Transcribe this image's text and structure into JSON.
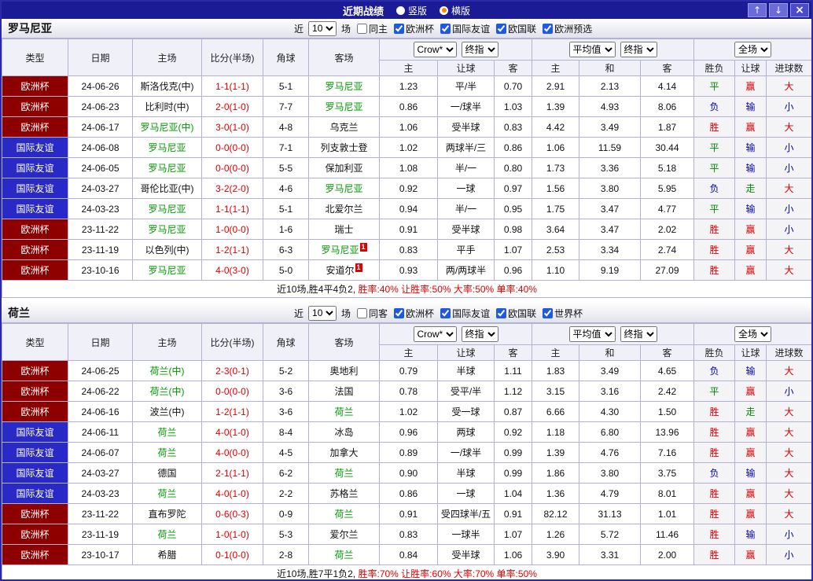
{
  "titlebar": {
    "title": "近期战绩",
    "layout_options": [
      {
        "label": "竖版",
        "selected": false
      },
      {
        "label": "横版",
        "selected": true
      }
    ],
    "selected_index": 1,
    "buttons": {
      "up": "↑",
      "down": "↓",
      "close": "×"
    }
  },
  "labels": {
    "near": "近",
    "games": "场"
  },
  "selectors": {
    "book": "Crow*",
    "book_stage": "终指",
    "avg": "平均值",
    "avg_stage": "终指",
    "scope": "全场"
  },
  "columns": {
    "main": [
      "类型",
      "日期",
      "主场",
      "比分(半场)",
      "角球",
      "客场"
    ],
    "sub": [
      "主",
      "让球",
      "客",
      "主",
      "和",
      "客",
      "胜负",
      "让球",
      "进球数"
    ]
  },
  "colors": {
    "comp": {
      "欧洲杯": "#8e0000",
      "国际友谊": "#2929c8"
    },
    "result": {
      "胜": "#d40000",
      "平": "#008a00",
      "负": "#0000cc",
      "赢": "#d40000",
      "输": "#0000cc",
      "走": "#008a00",
      "大": "#d40000",
      "小": "#0000cc"
    },
    "focal_team": "#009900",
    "score": "#e00000"
  },
  "sections": [
    {
      "team": "罗马尼亚",
      "filter": {
        "count": "10",
        "same_label": "同主",
        "same_checked": false,
        "competitions": [
          {
            "label": "欧洲杯",
            "checked": true
          },
          {
            "label": "国际友谊",
            "checked": true
          },
          {
            "label": "欧国联",
            "checked": true
          },
          {
            "label": "欧洲预选",
            "checked": true
          }
        ]
      },
      "rows": [
        {
          "comp": "欧洲杯",
          "date": "24-06-26",
          "home": "斯洛伐克(中)",
          "score": "1-1(1-1)",
          "corners": "5-1",
          "away": "罗马尼亚",
          "book": [
            "1.23",
            "平/半",
            "0.70"
          ],
          "avg": [
            "2.91",
            "2.13",
            "4.14"
          ],
          "results": [
            "平",
            "赢",
            "大"
          ],
          "home_rc": 0,
          "away_rc": 0
        },
        {
          "comp": "欧洲杯",
          "date": "24-06-23",
          "home": "比利时(中)",
          "score": "2-0(1-0)",
          "corners": "7-7",
          "away": "罗马尼亚",
          "book": [
            "0.86",
            "一/球半",
            "1.03"
          ],
          "avg": [
            "1.39",
            "4.93",
            "8.06"
          ],
          "results": [
            "负",
            "输",
            "小"
          ],
          "home_rc": 0,
          "away_rc": 0
        },
        {
          "comp": "欧洲杯",
          "date": "24-06-17",
          "home": "罗马尼亚(中)",
          "score": "3-0(1-0)",
          "corners": "4-8",
          "away": "乌克兰",
          "book": [
            "1.06",
            "受半球",
            "0.83"
          ],
          "avg": [
            "4.42",
            "3.49",
            "1.87"
          ],
          "results": [
            "胜",
            "赢",
            "大"
          ],
          "home_rc": 0,
          "away_rc": 0
        },
        {
          "comp": "国际友谊",
          "date": "24-06-08",
          "home": "罗马尼亚",
          "score": "0-0(0-0)",
          "corners": "7-1",
          "away": "列支敦士登",
          "book": [
            "1.02",
            "两球半/三",
            "0.86"
          ],
          "avg": [
            "1.06",
            "11.59",
            "30.44"
          ],
          "results": [
            "平",
            "输",
            "小"
          ],
          "home_rc": 0,
          "away_rc": 0
        },
        {
          "comp": "国际友谊",
          "date": "24-06-05",
          "home": "罗马尼亚",
          "score": "0-0(0-0)",
          "corners": "5-5",
          "away": "保加利亚",
          "book": [
            "1.08",
            "半/一",
            "0.80"
          ],
          "avg": [
            "1.73",
            "3.36",
            "5.18"
          ],
          "results": [
            "平",
            "输",
            "小"
          ],
          "home_rc": 0,
          "away_rc": 0
        },
        {
          "comp": "国际友谊",
          "date": "24-03-27",
          "home": "哥伦比亚(中)",
          "score": "3-2(2-0)",
          "corners": "4-6",
          "away": "罗马尼亚",
          "book": [
            "0.92",
            "一球",
            "0.97"
          ],
          "avg": [
            "1.56",
            "3.80",
            "5.95"
          ],
          "results": [
            "负",
            "走",
            "大"
          ],
          "home_rc": 0,
          "away_rc": 0
        },
        {
          "comp": "国际友谊",
          "date": "24-03-23",
          "home": "罗马尼亚",
          "score": "1-1(1-1)",
          "corners": "5-1",
          "away": "北爱尔兰",
          "book": [
            "0.94",
            "半/一",
            "0.95"
          ],
          "avg": [
            "1.75",
            "3.47",
            "4.77"
          ],
          "results": [
            "平",
            "输",
            "小"
          ],
          "home_rc": 0,
          "away_rc": 0
        },
        {
          "comp": "欧洲杯",
          "date": "23-11-22",
          "home": "罗马尼亚",
          "score": "1-0(0-0)",
          "corners": "1-6",
          "away": "瑞士",
          "book": [
            "0.91",
            "受半球",
            "0.98"
          ],
          "avg": [
            "3.64",
            "3.47",
            "2.02"
          ],
          "results": [
            "胜",
            "赢",
            "小"
          ],
          "home_rc": 0,
          "away_rc": 0
        },
        {
          "comp": "欧洲杯",
          "date": "23-11-19",
          "home": "以色列(中)",
          "score": "1-2(1-1)",
          "corners": "6-3",
          "away": "罗马尼亚",
          "book": [
            "0.83",
            "平手",
            "1.07"
          ],
          "avg": [
            "2.53",
            "3.34",
            "2.74"
          ],
          "results": [
            "胜",
            "赢",
            "大"
          ],
          "home_rc": 0,
          "away_rc": 1
        },
        {
          "comp": "欧洲杯",
          "date": "23-10-16",
          "home": "罗马尼亚",
          "score": "4-0(3-0)",
          "corners": "5-0",
          "away": "安道尔",
          "book": [
            "0.93",
            "两/两球半",
            "0.96"
          ],
          "avg": [
            "1.10",
            "9.19",
            "27.09"
          ],
          "results": [
            "胜",
            "赢",
            "大"
          ],
          "home_rc": 0,
          "away_rc": 1
        }
      ],
      "summary": {
        "prefix": "近10场,胜4平4负2,",
        "stats": "胜率:40% 让胜率:50% 大率:50% 单率:40%"
      }
    },
    {
      "team": "荷兰",
      "filter": {
        "count": "10",
        "same_label": "同客",
        "same_checked": false,
        "competitions": [
          {
            "label": "欧洲杯",
            "checked": true
          },
          {
            "label": "国际友谊",
            "checked": true
          },
          {
            "label": "欧国联",
            "checked": true
          },
          {
            "label": "世界杯",
            "checked": true
          }
        ]
      },
      "rows": [
        {
          "comp": "欧洲杯",
          "date": "24-06-25",
          "home": "荷兰(中)",
          "score": "2-3(0-1)",
          "corners": "5-2",
          "away": "奥地利",
          "book": [
            "0.79",
            "半球",
            "1.11"
          ],
          "avg": [
            "1.83",
            "3.49",
            "4.65"
          ],
          "results": [
            "负",
            "输",
            "大"
          ],
          "home_rc": 0,
          "away_rc": 0
        },
        {
          "comp": "欧洲杯",
          "date": "24-06-22",
          "home": "荷兰(中)",
          "score": "0-0(0-0)",
          "corners": "3-6",
          "away": "法国",
          "book": [
            "0.78",
            "受平/半",
            "1.12"
          ],
          "avg": [
            "3.15",
            "3.16",
            "2.42"
          ],
          "results": [
            "平",
            "赢",
            "小"
          ],
          "home_rc": 0,
          "away_rc": 0
        },
        {
          "comp": "欧洲杯",
          "date": "24-06-16",
          "home": "波兰(中)",
          "score": "1-2(1-1)",
          "corners": "3-6",
          "away": "荷兰",
          "book": [
            "1.02",
            "受一球",
            "0.87"
          ],
          "avg": [
            "6.66",
            "4.30",
            "1.50"
          ],
          "results": [
            "胜",
            "走",
            "大"
          ],
          "home_rc": 0,
          "away_rc": 0
        },
        {
          "comp": "国际友谊",
          "date": "24-06-11",
          "home": "荷兰",
          "score": "4-0(1-0)",
          "corners": "8-4",
          "away": "冰岛",
          "book": [
            "0.96",
            "两球",
            "0.92"
          ],
          "avg": [
            "1.18",
            "6.80",
            "13.96"
          ],
          "results": [
            "胜",
            "赢",
            "大"
          ],
          "home_rc": 0,
          "away_rc": 0
        },
        {
          "comp": "国际友谊",
          "date": "24-06-07",
          "home": "荷兰",
          "score": "4-0(0-0)",
          "corners": "4-5",
          "away": "加拿大",
          "book": [
            "0.89",
            "一/球半",
            "0.99"
          ],
          "avg": [
            "1.39",
            "4.76",
            "7.16"
          ],
          "results": [
            "胜",
            "赢",
            "大"
          ],
          "home_rc": 0,
          "away_rc": 0
        },
        {
          "comp": "国际友谊",
          "date": "24-03-27",
          "home": "德国",
          "score": "2-1(1-1)",
          "corners": "6-2",
          "away": "荷兰",
          "book": [
            "0.90",
            "半球",
            "0.99"
          ],
          "avg": [
            "1.86",
            "3.80",
            "3.75"
          ],
          "results": [
            "负",
            "输",
            "大"
          ],
          "home_rc": 0,
          "away_rc": 0
        },
        {
          "comp": "国际友谊",
          "date": "24-03-23",
          "home": "荷兰",
          "score": "4-0(1-0)",
          "corners": "2-2",
          "away": "苏格兰",
          "book": [
            "0.86",
            "一球",
            "1.04"
          ],
          "avg": [
            "1.36",
            "4.79",
            "8.01"
          ],
          "results": [
            "胜",
            "赢",
            "大"
          ],
          "home_rc": 0,
          "away_rc": 0
        },
        {
          "comp": "欧洲杯",
          "date": "23-11-22",
          "home": "直布罗陀",
          "score": "0-6(0-3)",
          "corners": "0-9",
          "away": "荷兰",
          "book": [
            "0.91",
            "受四球半/五",
            "0.91"
          ],
          "avg": [
            "82.12",
            "31.13",
            "1.01"
          ],
          "results": [
            "胜",
            "赢",
            "大"
          ],
          "home_rc": 0,
          "away_rc": 0
        },
        {
          "comp": "欧洲杯",
          "date": "23-11-19",
          "home": "荷兰",
          "score": "1-0(1-0)",
          "corners": "5-3",
          "away": "爱尔兰",
          "book": [
            "0.83",
            "一球半",
            "1.07"
          ],
          "avg": [
            "1.26",
            "5.72",
            "11.46"
          ],
          "results": [
            "胜",
            "输",
            "小"
          ],
          "home_rc": 0,
          "away_rc": 0
        },
        {
          "comp": "欧洲杯",
          "date": "23-10-17",
          "home": "希腊",
          "score": "0-1(0-0)",
          "corners": "2-8",
          "away": "荷兰",
          "book": [
            "0.84",
            "受半球",
            "1.06"
          ],
          "avg": [
            "3.90",
            "3.31",
            "2.00"
          ],
          "results": [
            "胜",
            "赢",
            "小"
          ],
          "home_rc": 0,
          "away_rc": 0
        }
      ],
      "summary": {
        "prefix": "近10场,胜7平1负2,",
        "stats": "胜率:70% 让胜率:60% 大率:70% 单率:50%"
      }
    }
  ]
}
